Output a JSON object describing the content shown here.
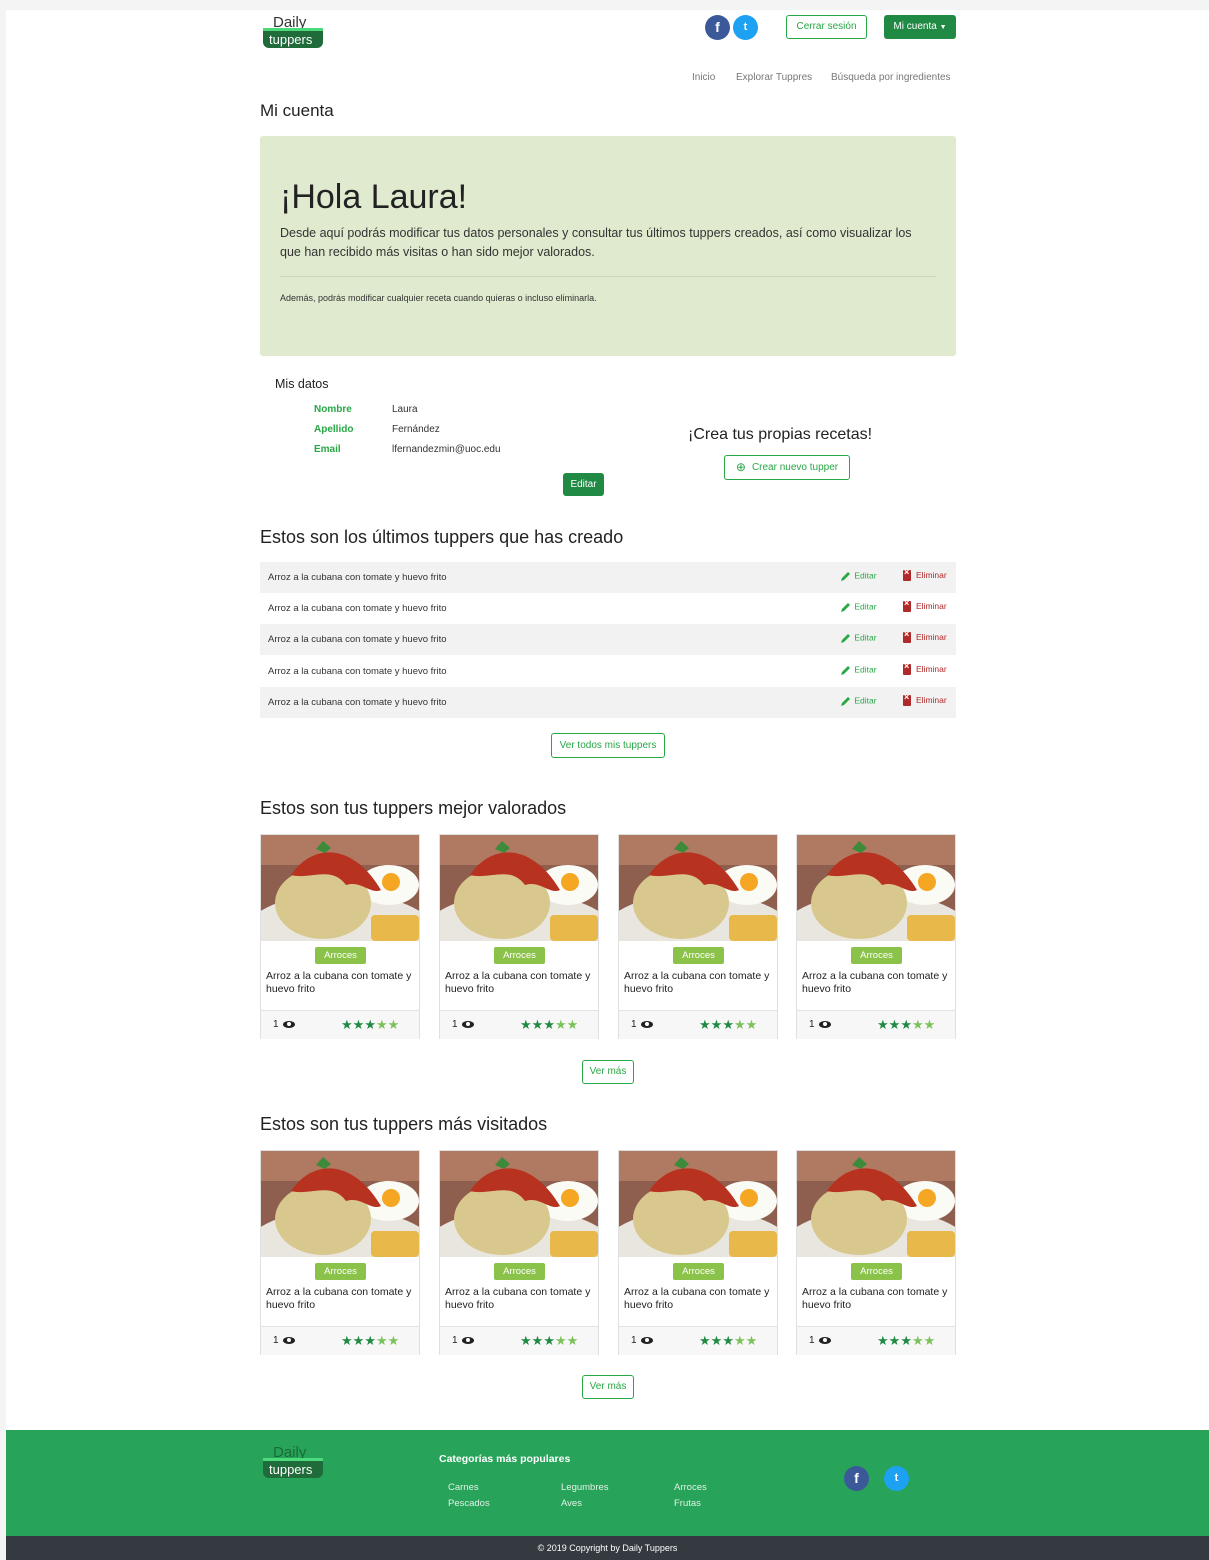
{
  "brand": {
    "line1": "Daily",
    "line2": "tuppers"
  },
  "header": {
    "facebook_glyph": "f",
    "twitter_glyph": "t",
    "logout_label": "Cerrar sesión",
    "account_label": "Mi cuenta"
  },
  "nav": {
    "items": [
      "Inicio",
      "Explorar Tuppres",
      "Búsqueda por ingredientes"
    ]
  },
  "page_title": "Mi cuenta",
  "jumbotron": {
    "greeting": "¡Hola Laura!",
    "lead": "Desde aquí podrás modificar tus datos personales y consultar tus últimos tuppers creados, así como visualizar los que han recibido más visitas o han sido mejor valorados.",
    "note": "Además, podrás modificar cualquier receta cuando quieras o incluso eliminarla."
  },
  "profile": {
    "title": "Mis datos",
    "fields": [
      {
        "label": "Nombre",
        "value": "Laura"
      },
      {
        "label": "Apellido",
        "value": "Fernández"
      },
      {
        "label": "Email",
        "value": "lfernandezmin@uoc.edu"
      }
    ],
    "edit_label": "Editar"
  },
  "create": {
    "title": "¡Crea tus propias recetas!",
    "button_label": "Crear nuevo tupper",
    "button_glyph": "⊕"
  },
  "latest": {
    "title": "Estos son los últimos tuppers que has creado",
    "rows": [
      "Arroz a la cubana con tomate y huevo frito",
      "Arroz a la cubana con tomate y huevo frito",
      "Arroz a la cubana con tomate y huevo frito",
      "Arroz a la cubana con tomate y huevo frito",
      "Arroz a la cubana con tomate y huevo frito"
    ],
    "edit_label": "Editar",
    "delete_label": "Eliminar",
    "view_all_label": "Ver todos mis tuppers"
  },
  "best_rated": {
    "title": "Estos son tus tuppers mejor valorados",
    "cards": [
      {
        "badge": "Arroces",
        "title": "Arroz a la cubana con tomate y huevo frito",
        "views": "1",
        "stars": 5
      },
      {
        "badge": "Arroces",
        "title": "Arroz a la cubana con tomate y huevo frito",
        "views": "1",
        "stars": 5
      },
      {
        "badge": "Arroces",
        "title": "Arroz a la cubana con tomate y huevo frito",
        "views": "1",
        "stars": 5
      },
      {
        "badge": "Arroces",
        "title": "Arroz a la cubana con tomate y huevo frito",
        "views": "1",
        "stars": 5
      }
    ],
    "more_label": "Ver más"
  },
  "most_visited": {
    "title": "Estos son tus tuppers más visitados",
    "cards": [
      {
        "badge": "Arroces",
        "title": "Arroz a la cubana con tomate y huevo frito",
        "views": "1",
        "stars": 5
      },
      {
        "badge": "Arroces",
        "title": "Arroz a la cubana con tomate y huevo frito",
        "views": "1",
        "stars": 5
      },
      {
        "badge": "Arroces",
        "title": "Arroz a la cubana con tomate y huevo frito",
        "views": "1",
        "stars": 5
      },
      {
        "badge": "Arroces",
        "title": "Arroz a la cubana con tomate y huevo frito",
        "views": "1",
        "stars": 5
      }
    ],
    "more_label": "Ver más"
  },
  "footer": {
    "categories_title": "Categorías más populares",
    "categories": [
      "Carnes",
      "Legumbres",
      "Arroces",
      "Pescados",
      "Aves",
      "Frutas"
    ],
    "copyright": "© 2019 Copyright by Daily Tuppers"
  },
  "colors": {
    "primary": "#28a745",
    "dark_green": "#208a44",
    "jumbotron": "#e0eacf",
    "danger": "#b02a2a",
    "footer": "#28a35a"
  }
}
